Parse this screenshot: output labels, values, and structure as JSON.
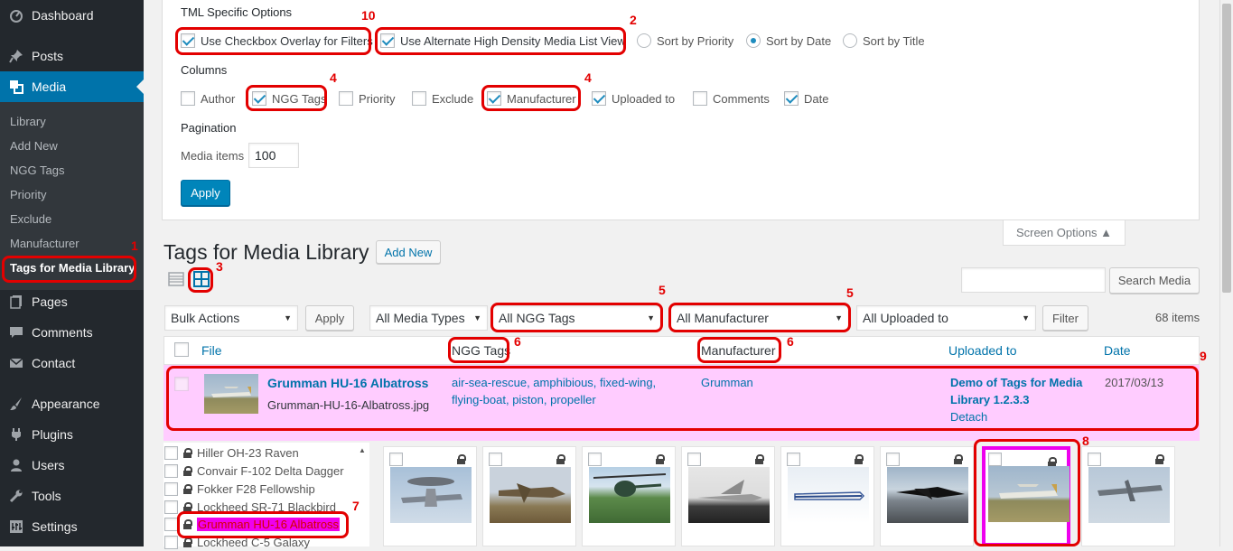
{
  "menu": {
    "top_items": [
      {
        "label": "Dashboard",
        "icon": "dashboard-icon"
      },
      {
        "label": "Posts",
        "icon": "pushpin-icon"
      },
      {
        "label": "Media",
        "icon": "media-icon"
      }
    ],
    "media_submenu": [
      "Library",
      "Add New",
      "NGG Tags",
      "Priority",
      "Exclude",
      "Manufacturer",
      "Tags for Media Library"
    ],
    "bottom_items": [
      {
        "label": "Pages",
        "icon": "pages-icon"
      },
      {
        "label": "Comments",
        "icon": "comments-icon"
      },
      {
        "label": "Contact",
        "icon": "envelope-icon"
      },
      {
        "label": "Appearance",
        "icon": "paintbrush-icon"
      },
      {
        "label": "Plugins",
        "icon": "plugin-icon"
      },
      {
        "label": "Users",
        "icon": "users-icon"
      },
      {
        "label": "Tools",
        "icon": "wrench-icon"
      },
      {
        "label": "Settings",
        "icon": "settings-icon"
      }
    ]
  },
  "screen_options": {
    "tml_heading": "TML Specific Options",
    "checkbox_overlay": "Use Checkbox Overlay for Filters",
    "alt_density": "Use Alternate High Density Media List View",
    "sort_priority": "Sort by Priority",
    "sort_date": "Sort by Date",
    "sort_title": "Sort by Title",
    "columns_heading": "Columns",
    "columns": [
      {
        "label": "Author",
        "checked": false
      },
      {
        "label": "NGG Tags",
        "checked": true
      },
      {
        "label": "Priority",
        "checked": false
      },
      {
        "label": "Exclude",
        "checked": false
      },
      {
        "label": "Manufacturer",
        "checked": true
      },
      {
        "label": "Uploaded to",
        "checked": true
      },
      {
        "label": "Comments",
        "checked": false
      },
      {
        "label": "Date",
        "checked": true
      }
    ],
    "pagination_heading": "Pagination",
    "media_items_label": "Media items",
    "media_items_value": "100",
    "apply": "Apply",
    "tab_label": "Screen Options ▲"
  },
  "page": {
    "title": "Tags for Media Library",
    "add_new": "Add New",
    "search_button": "Search Media",
    "bulk_actions": "Bulk Actions",
    "apply": "Apply",
    "media_types": "All Media Types",
    "ngg_tags_filter": "All NGG Tags",
    "manufacturer_filter": "All Manufacturer",
    "uploaded_filter": "All Uploaded to",
    "filter": "Filter",
    "count": "68 items"
  },
  "table": {
    "headers": {
      "file": "File",
      "ngg_tags": "NGG Tags",
      "manufacturer": "Manufacturer",
      "uploaded_to": "Uploaded to",
      "date": "Date"
    },
    "row": {
      "title": "Grumman HU-16 Albatross",
      "filename": "Grumman-HU-16-Albatross.jpg",
      "tags_line1": "air-sea-rescue, amphibious, fixed-wing,",
      "tags_line2": "flying-boat, piston, propeller",
      "manufacturer": "Grumman",
      "uploaded_line1": "Demo of Tags for Media",
      "uploaded_line2": "Library 1.2.3.3",
      "detach": "Detach",
      "date": "2017/03/13"
    }
  },
  "list": [
    "Hiller OH-23 Raven",
    "Convair F-102 Delta Dagger",
    "Fokker F28 Fellowship",
    "Lockheed SR-71 Blackbird",
    "Grumman HU-16 Albatross",
    "Lockheed C-5 Galaxy"
  ],
  "annotations": [
    "1",
    "2",
    "3",
    "4",
    "4",
    "5",
    "5",
    "6",
    "6",
    "7",
    "8",
    "9",
    "10"
  ],
  "colors": {
    "accent": "#0073aa",
    "highlight": "#ffccff",
    "annotation": "#e30000",
    "selected_tile": "#ee00ee"
  }
}
